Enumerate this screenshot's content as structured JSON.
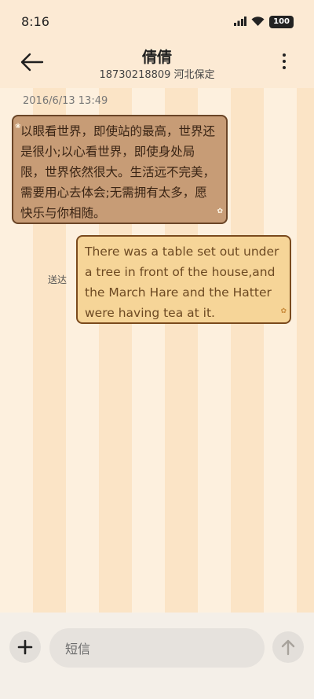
{
  "status_bar": {
    "time": "8:16",
    "battery": "100"
  },
  "header": {
    "title": "倩倩",
    "subtitle": "18730218809 河北保定"
  },
  "conversation": {
    "timestamp": "2016/6/13 13:49",
    "messages": [
      {
        "direction": "incoming",
        "text": "以眼看世界，即使站的最高，世界还是很小;以心看世界，即使身处局限，世界依然很大。生活远不完美，需要用心去体会;无需拥有太多，愿快乐与你相随。"
      },
      {
        "direction": "outgoing",
        "text": "There was a table set out under a tree in front of the house,and the March Hare and the Hatter were having tea at it.",
        "status": "送达"
      }
    ]
  },
  "composer": {
    "placeholder": "短信"
  },
  "icons": [
    "back-arrow-icon",
    "more-vertical-icon",
    "signal-icon",
    "wifi-icon",
    "battery-icon",
    "plus-icon",
    "send-arrow-icon"
  ],
  "colors": {
    "bubble_incoming": "#c79c76",
    "bubble_outgoing": "#f6d598",
    "stripe_light": "#fdf0de",
    "stripe_dark": "#fbe4c6"
  }
}
